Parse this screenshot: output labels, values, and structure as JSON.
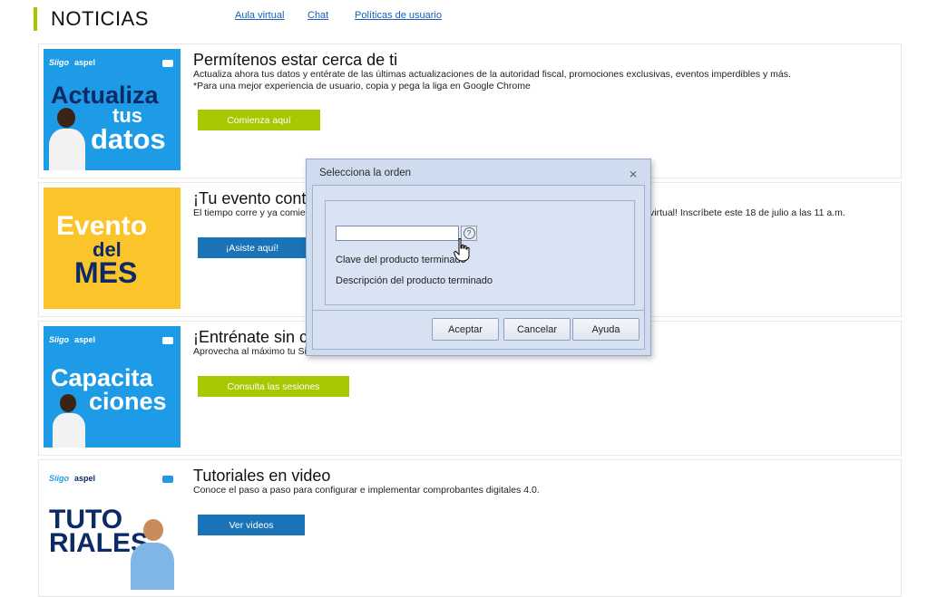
{
  "header": {
    "title": "NOTICIAS",
    "links": [
      "Aula virtual",
      "Chat",
      "Políticas de usuario"
    ]
  },
  "colors": {
    "accent_green": "#a6c800",
    "accent_blue": "#1a73b6",
    "promo_blue": "#1e9be6",
    "promo_yellow": "#fcc42b"
  },
  "cards": [
    {
      "title": "Permítenos estar cerca de ti",
      "desc1": "Actualiza ahora tus datos y entérate de las últimas actualizaciones de la autoridad fiscal, promociones exclusivas, eventos imperdibles y más.",
      "desc2": "*Para una mejor experiencia de usuario, copia y pega la liga en Google Chrome",
      "button": "Comienza aquí",
      "image": {
        "logo": "Siigo",
        "logo2": "aspel",
        "line1": "Actualiza",
        "line2": "tus",
        "line3": "datos"
      }
    },
    {
      "title": "¡Tu evento cont",
      "desc1": "El tiempo corre y ya comien",
      "desc1_right": "virtual! Inscríbete este 18 de julio a las 11 a.m.",
      "button": "¡Asiste aquí!",
      "image": {
        "line1": "Evento",
        "line2": "del",
        "line3": "MES"
      }
    },
    {
      "title": "¡Entrénate sin c",
      "desc1": "Aprovecha al máximo tu Siig",
      "button": "Consulta las sesiones",
      "image": {
        "logo": "Siigo",
        "logo2": "aspel",
        "line1": "Capacita",
        "line2": "ciones"
      }
    },
    {
      "title": "Tutoriales en video",
      "desc1": "Conoce el paso a paso para configurar e implementar comprobantes digitales 4.0.",
      "button": "Ver videos",
      "image": {
        "logo": "Siigo",
        "logo2": "aspel",
        "line1": "TUTO",
        "line2": "RIALES"
      }
    }
  ],
  "dialog": {
    "title": "Selecciona la orden",
    "input_value": "",
    "help_label": "?",
    "label_clave": "Clave del producto terminado",
    "label_desc": "Descripción del producto terminado",
    "buttons": {
      "accept": "Aceptar",
      "cancel": "Cancelar",
      "help": "Ayuda"
    }
  }
}
